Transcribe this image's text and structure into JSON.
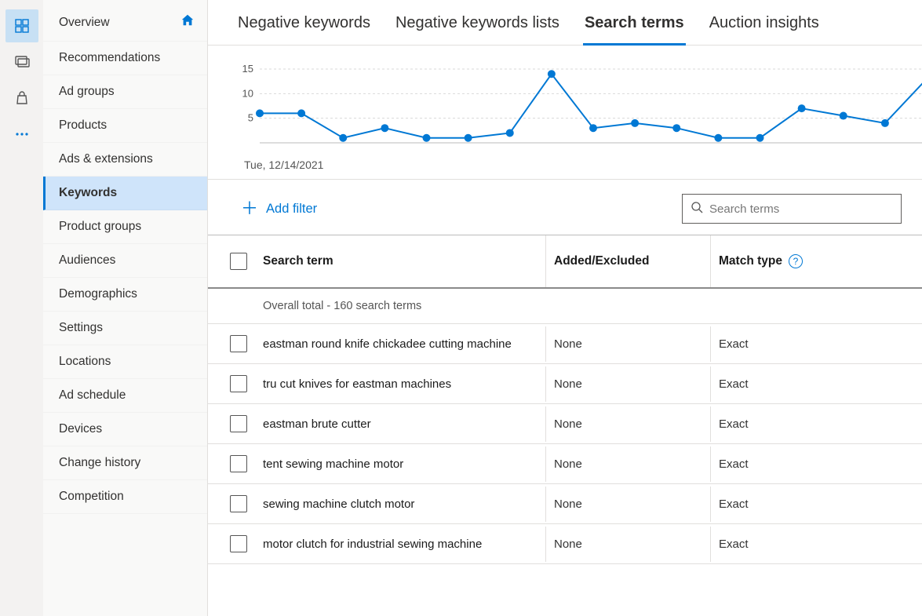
{
  "iconbar": {
    "items": [
      {
        "name": "overview-icon",
        "glyph": "grid",
        "selected": true
      },
      {
        "name": "chat-icon",
        "glyph": "chat",
        "selected": false
      },
      {
        "name": "briefcase-icon",
        "glyph": "bag",
        "selected": false
      },
      {
        "name": "more-icon",
        "glyph": "dots",
        "selected": false
      }
    ]
  },
  "sidebar": {
    "items": [
      {
        "label": "Overview",
        "home": true
      },
      {
        "label": "Recommendations"
      },
      {
        "label": "Ad groups"
      },
      {
        "label": "Products"
      },
      {
        "label": "Ads & extensions"
      },
      {
        "label": "Keywords",
        "active": true
      },
      {
        "label": "Product groups"
      },
      {
        "label": "Audiences"
      },
      {
        "label": "Demographics"
      },
      {
        "label": "Settings"
      },
      {
        "label": "Locations"
      },
      {
        "label": "Ad schedule"
      },
      {
        "label": "Devices"
      },
      {
        "label": "Change history"
      },
      {
        "label": "Competition"
      }
    ]
  },
  "tabs": {
    "items": [
      {
        "label": "Negative keywords"
      },
      {
        "label": "Negative keywords lists"
      },
      {
        "label": "Search terms",
        "active": true
      },
      {
        "label": "Auction insights"
      }
    ]
  },
  "chart": {
    "date_label": "Tue, 12/14/2021"
  },
  "chart_data": {
    "type": "line",
    "title": "",
    "xlabel": "",
    "ylabel": "",
    "ylim": [
      0,
      15
    ],
    "yticks": [
      5,
      10,
      15
    ],
    "series": [
      {
        "name": "metric",
        "values": [
          6,
          6,
          1,
          3,
          1,
          1,
          2,
          14,
          3,
          4,
          3,
          1,
          1,
          7,
          5.5,
          4,
          13
        ]
      }
    ]
  },
  "toolbar": {
    "add_filter": "Add filter",
    "search_placeholder": "Search terms"
  },
  "table": {
    "columns": {
      "term": "Search term",
      "added": "Added/Excluded",
      "match": "Match type"
    },
    "total_label": "Overall total - 160 search terms",
    "rows": [
      {
        "term": "eastman round knife chickadee cutting machine",
        "added": "None",
        "match": "Exact"
      },
      {
        "term": "tru cut knives for eastman machines",
        "added": "None",
        "match": "Exact"
      },
      {
        "term": "eastman brute cutter",
        "added": "None",
        "match": "Exact"
      },
      {
        "term": "tent sewing machine motor",
        "added": "None",
        "match": "Exact"
      },
      {
        "term": "sewing machine clutch motor",
        "added": "None",
        "match": "Exact"
      },
      {
        "term": "motor clutch for industrial sewing machine",
        "added": "None",
        "match": "Exact"
      }
    ]
  }
}
